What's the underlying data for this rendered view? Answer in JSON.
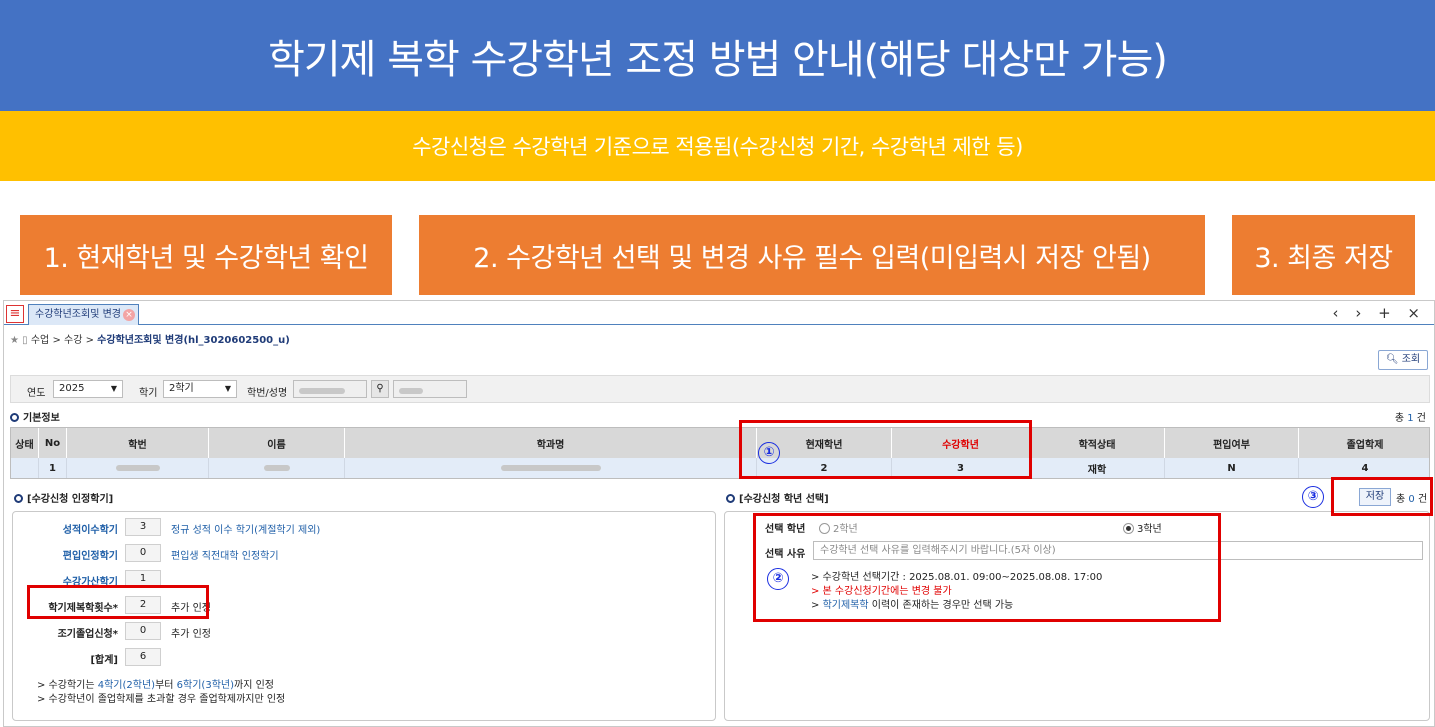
{
  "banner": {
    "title": "학기제 복학 수강학년 조정 방법 안내(해당 대상만 가능)"
  },
  "subbanner": {
    "text": "수강신청은 수강학년 기준으로 적용됨(수강신청 기간, 수강학년 제한 등)"
  },
  "steps": [
    {
      "label": "1. 현재학년 및 수강학년 확인"
    },
    {
      "label": "2. 수강학년 선택 및 변경 사유 필수 입력(미입력시 저장 안됨)"
    },
    {
      "label": "3. 최종 저장"
    }
  ],
  "app": {
    "menu_icon": "hamburger-icon",
    "tab_label": "수강학년조회및 변경",
    "window_controls": "‹ › + ×",
    "breadcrumb_prefix": "수업 > 수강 >",
    "breadcrumb_current": "수강학년조회및 변경(hl_3020602500_u)",
    "search_button": "조회",
    "filter": {
      "year_label": "연도",
      "year_value": "2025",
      "term_label": "학기",
      "term_value": "2학기",
      "student_label": "학번/성명"
    },
    "basic_info": {
      "title": "기본정보",
      "count_prefix": "총",
      "count": "1",
      "count_suffix": "건",
      "columns": [
        "상태",
        "No",
        "학번",
        "이름",
        "학과명",
        "현재학년",
        "수강학년",
        "학적상태",
        "편입여부",
        "졸업학제"
      ],
      "row": {
        "no": "1",
        "current_year": "2",
        "course_year": "3",
        "status": "재학",
        "transfer": "N",
        "grad": "4"
      }
    },
    "credit": {
      "title": "[수강신청 인정학기]",
      "rows": [
        {
          "label": "성적이수학기",
          "value": "3",
          "note": "정규 성적 이수 학기(계절학기 제외)"
        },
        {
          "label": "편입인정학기",
          "value": "0",
          "note": "편입생 직전대학 인정학기"
        },
        {
          "label": "수강가산학기",
          "value": "1",
          "note": ""
        },
        {
          "label": "학기제복학횟수*",
          "value": "2",
          "note": "추가 인정"
        },
        {
          "label": "조기졸업신청*",
          "value": "0",
          "note": "추가 인정"
        },
        {
          "label": "[합계]",
          "value": "6",
          "note": ""
        }
      ],
      "footnote1_a": "> 수강학기는 ",
      "footnote1_b": "4학기(2학년)",
      "footnote1_c": "부터 ",
      "footnote1_d": "6학기(3학년)",
      "footnote1_e": "까지 인정",
      "footnote2": "> 수강학년이 졸업학제를 초과할 경우 졸업학제까지만 인정"
    },
    "select": {
      "title": "[수강신청 학년 선택]",
      "save_button": "저장",
      "count_prefix": "총",
      "count": "0",
      "count_suffix": "건",
      "grade_label": "선택 학년",
      "option1": "2학년",
      "option2": "3학년",
      "reason_label": "선택 사유",
      "reason_placeholder": "수강학년 선택 사유를 입력해주시기 바랍니다.(5자 이상)",
      "note1": "> 수강학년 선택기간 : 2025.08.01. 09:00~2025.08.08. 17:00",
      "note2": "> 본 수강신청기간에는 변경 불가",
      "note3_a": "> ",
      "note3_b": "학기제복학",
      "note3_c": " 이력이 존재하는 경우만 선택 가능"
    },
    "markers": [
      "①",
      "②",
      "③"
    ]
  }
}
